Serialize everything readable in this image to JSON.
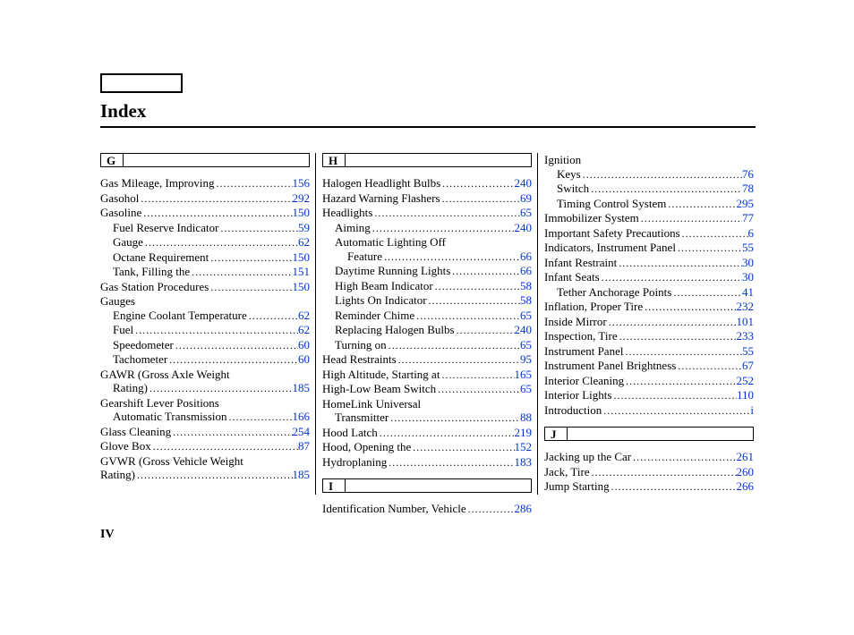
{
  "title": "Index",
  "footer": "IV",
  "columns": [
    {
      "groups": [
        {
          "letter": "G",
          "entries": [
            {
              "label": "Gas Mileage, Improving",
              "page": "156",
              "indent": 0
            },
            {
              "label": "Gasohol",
              "page": "292",
              "indent": 0
            },
            {
              "label": "Gasoline",
              "page": "150",
              "indent": 0
            },
            {
              "label": "Fuel Reserve Indicator",
              "page": "59",
              "indent": 1
            },
            {
              "label": "Gauge",
              "page": "62",
              "indent": 1
            },
            {
              "label": "Octane Requirement",
              "page": "150",
              "indent": 1
            },
            {
              "label": "Tank, Filling the",
              "page": "151",
              "indent": 1
            },
            {
              "label": "Gas Station Procedures",
              "page": "150",
              "indent": 0
            },
            {
              "label": "Gauges",
              "page": "",
              "indent": 0,
              "nolink": true
            },
            {
              "label": "Engine Coolant Temperature",
              "page": "62",
              "indent": 1
            },
            {
              "label": "Fuel",
              "page": "62",
              "indent": 1
            },
            {
              "label": "Speedometer",
              "page": "60",
              "indent": 1
            },
            {
              "label": "Tachometer",
              "page": "60",
              "indent": 1
            },
            {
              "label": "GAWR (Gross Axle Weight",
              "page": "",
              "indent": 0,
              "nolink": true
            },
            {
              "label": "Rating)",
              "page": "185",
              "indent": 1
            },
            {
              "label": "Gearshift Lever Positions",
              "page": "",
              "indent": 0,
              "nolink": true
            },
            {
              "label": "Automatic Transmission",
              "page": "166",
              "indent": 1
            },
            {
              "label": "Glass Cleaning",
              "page": "254",
              "indent": 0
            },
            {
              "label": "Glove Box",
              "page": "87",
              "indent": 0
            },
            {
              "label": "GVWR (Gross Vehicle Weight",
              "page": "",
              "indent": 0,
              "nolink": true
            },
            {
              "label": "Rating)",
              "page": "185",
              "indent": 0
            }
          ]
        }
      ]
    },
    {
      "groups": [
        {
          "letter": "H",
          "entries": [
            {
              "label": "Halogen Headlight Bulbs",
              "page": "240",
              "indent": 0
            },
            {
              "label": "Hazard Warning Flashers",
              "page": "69",
              "indent": 0
            },
            {
              "label": "Headlights",
              "page": "65",
              "indent": 0
            },
            {
              "label": "Aiming",
              "page": "240",
              "indent": 1
            },
            {
              "label": "Automatic Lighting Off",
              "page": "",
              "indent": 1,
              "nolink": true
            },
            {
              "label": "Feature",
              "page": "66",
              "indent": 2
            },
            {
              "label": "Daytime Running Lights",
              "page": "66",
              "indent": 1
            },
            {
              "label": "High Beam Indicator",
              "page": "58",
              "indent": 1
            },
            {
              "label": "Lights On Indicator",
              "page": "58",
              "indent": 1
            },
            {
              "label": "Reminder Chime",
              "page": "65",
              "indent": 1
            },
            {
              "label": "Replacing Halogen Bulbs",
              "page": "240",
              "indent": 1
            },
            {
              "label": "Turning on",
              "page": "65",
              "indent": 1
            },
            {
              "label": "Head Restraints",
              "page": "95",
              "indent": 0
            },
            {
              "label": "High Altitude, Starting at",
              "page": "165",
              "indent": 0
            },
            {
              "label": "High-Low Beam Switch",
              "page": "65",
              "indent": 0
            },
            {
              "label": "HomeLink Universal",
              "page": "",
              "indent": 0,
              "nolink": true
            },
            {
              "label": "Transmitter",
              "page": "88",
              "indent": 1
            },
            {
              "label": "Hood Latch",
              "page": "219",
              "indent": 0
            },
            {
              "label": "Hood, Opening the",
              "page": "152",
              "indent": 0
            },
            {
              "label": "Hydroplaning",
              "page": "183",
              "indent": 0
            }
          ]
        },
        {
          "letter": "I",
          "entries": [
            {
              "label": "Identification Number, Vehicle",
              "page": "286",
              "indent": 0
            }
          ]
        }
      ]
    },
    {
      "groups": [
        {
          "letter": null,
          "entries": [
            {
              "label": "Ignition",
              "page": "",
              "indent": 0,
              "nolink": true
            },
            {
              "label": "Keys",
              "page": "76",
              "indent": 1
            },
            {
              "label": "Switch",
              "page": "78",
              "indent": 1
            },
            {
              "label": "Timing Control System",
              "page": "295",
              "indent": 1
            },
            {
              "label": "Immobilizer System",
              "page": "77",
              "indent": 0
            },
            {
              "label": "Important Safety Precautions",
              "page": "6",
              "indent": 0
            },
            {
              "label": "Indicators, Instrument Panel",
              "page": "55",
              "indent": 0
            },
            {
              "label": "Infant Restraint",
              "page": "30",
              "indent": 0
            },
            {
              "label": "Infant Seats",
              "page": "30",
              "indent": 0
            },
            {
              "label": "Tether Anchorage Points",
              "page": "41",
              "indent": 1
            },
            {
              "label": "Inflation, Proper Tire",
              "page": "232",
              "indent": 0
            },
            {
              "label": "Inside Mirror",
              "page": "101",
              "indent": 0
            },
            {
              "label": "Inspection, Tire",
              "page": "233",
              "indent": 0
            },
            {
              "label": "Instrument Panel",
              "page": "55",
              "indent": 0
            },
            {
              "label": "Instrument Panel Brightness",
              "page": "67",
              "indent": 0
            },
            {
              "label": "Interior Cleaning",
              "page": "252",
              "indent": 0
            },
            {
              "label": "Interior Lights",
              "page": "110",
              "indent": 0
            },
            {
              "label": "Introduction",
              "page": "i",
              "indent": 0
            }
          ]
        },
        {
          "letter": "J",
          "entries": [
            {
              "label": "Jacking up the Car",
              "page": "261",
              "indent": 0
            },
            {
              "label": "Jack, Tire",
              "page": "260",
              "indent": 0
            },
            {
              "label": "Jump Starting",
              "page": "266",
              "indent": 0
            }
          ]
        }
      ]
    }
  ]
}
